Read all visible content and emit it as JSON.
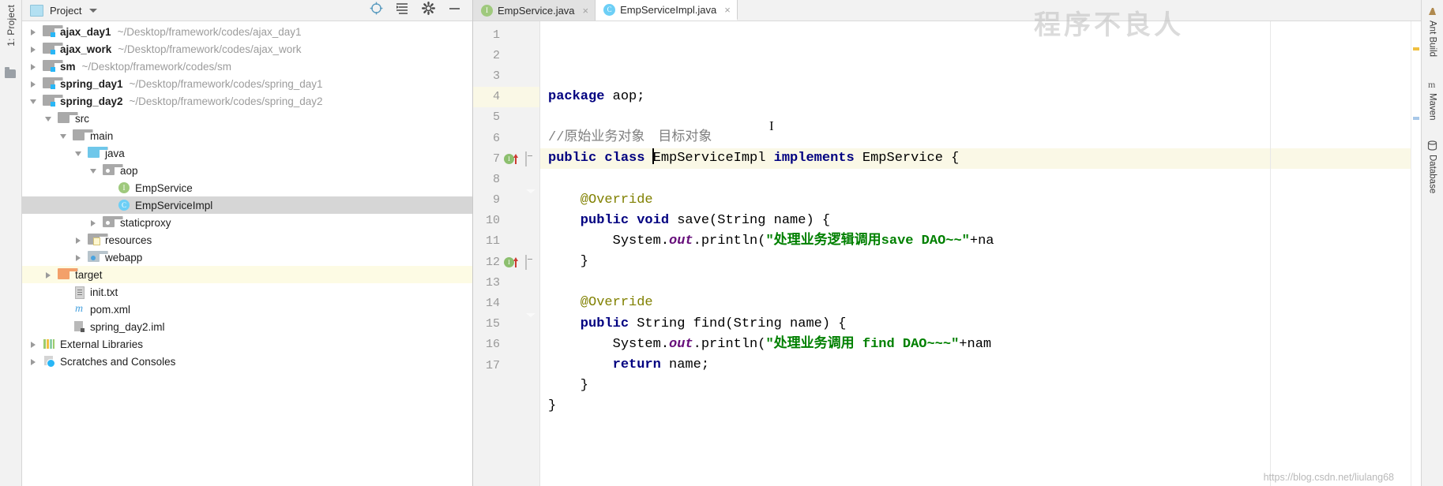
{
  "window": {
    "left_strip_label": "1: Project",
    "watermark": "程序不良人",
    "blog_url": "https://blog.csdn.net/liulang68"
  },
  "project_panel": {
    "title": "Project",
    "icons": {
      "panel": "project-icon",
      "dropdown": "chevron-down-icon",
      "locate": "crosshair-target-icon",
      "collapse": "collapse-all-icon",
      "settings": "gear-icon",
      "hide": "minimize-icon"
    },
    "tree": [
      {
        "name": "ajax_day1",
        "path": "~/Desktop/framework/codes/ajax_day1",
        "indent": 0,
        "arrow": "right",
        "icon": "module",
        "bold": true,
        "state": "normal"
      },
      {
        "name": "ajax_work",
        "path": "~/Desktop/framework/codes/ajax_work",
        "indent": 0,
        "arrow": "right",
        "icon": "module",
        "bold": true,
        "state": "normal"
      },
      {
        "name": "sm",
        "path": "~/Desktop/framework/codes/sm",
        "indent": 0,
        "arrow": "right",
        "icon": "module",
        "bold": true,
        "state": "normal"
      },
      {
        "name": "spring_day1",
        "path": "~/Desktop/framework/codes/spring_day1",
        "indent": 0,
        "arrow": "right",
        "icon": "module",
        "bold": true,
        "state": "normal"
      },
      {
        "name": "spring_day2",
        "path": "~/Desktop/framework/codes/spring_day2",
        "indent": 0,
        "arrow": "down",
        "icon": "module",
        "bold": true,
        "state": "normal"
      },
      {
        "name": "src",
        "path": "",
        "indent": 1,
        "arrow": "down",
        "icon": "folder",
        "bold": false,
        "state": "normal"
      },
      {
        "name": "main",
        "path": "",
        "indent": 2,
        "arrow": "down",
        "icon": "folder",
        "bold": false,
        "state": "normal"
      },
      {
        "name": "java",
        "path": "",
        "indent": 3,
        "arrow": "down",
        "icon": "src",
        "bold": false,
        "state": "normal"
      },
      {
        "name": "aop",
        "path": "",
        "indent": 4,
        "arrow": "down",
        "icon": "pkg",
        "bold": false,
        "state": "normal"
      },
      {
        "name": "EmpService",
        "path": "",
        "indent": 5,
        "arrow": "none",
        "icon": "iface",
        "bold": false,
        "state": "normal"
      },
      {
        "name": "EmpServiceImpl",
        "path": "",
        "indent": 5,
        "arrow": "none",
        "icon": "class",
        "bold": false,
        "state": "selected"
      },
      {
        "name": "staticproxy",
        "path": "",
        "indent": 4,
        "arrow": "right",
        "icon": "pkg",
        "bold": false,
        "state": "normal"
      },
      {
        "name": "resources",
        "path": "",
        "indent": 3,
        "arrow": "right",
        "icon": "res",
        "bold": false,
        "state": "normal"
      },
      {
        "name": "webapp",
        "path": "",
        "indent": 3,
        "arrow": "right",
        "icon": "web",
        "bold": false,
        "state": "normal"
      },
      {
        "name": "target",
        "path": "",
        "indent": 1,
        "arrow": "right",
        "icon": "target",
        "bold": false,
        "state": "highlight"
      },
      {
        "name": "init.txt",
        "path": "",
        "indent": 2,
        "arrow": "none",
        "icon": "txt",
        "bold": false,
        "state": "normal"
      },
      {
        "name": "pom.xml",
        "path": "",
        "indent": 2,
        "arrow": "none",
        "icon": "maven",
        "bold": false,
        "state": "normal"
      },
      {
        "name": "spring_day2.iml",
        "path": "",
        "indent": 2,
        "arrow": "none",
        "icon": "iml",
        "bold": false,
        "state": "normal"
      },
      {
        "name": "External Libraries",
        "path": "",
        "indent": 0,
        "arrow": "right",
        "icon": "libs",
        "bold": false,
        "state": "normal"
      },
      {
        "name": "Scratches and Consoles",
        "path": "",
        "indent": 0,
        "arrow": "right",
        "icon": "scratch",
        "bold": false,
        "state": "normal"
      }
    ]
  },
  "editor": {
    "tabs": [
      {
        "label": "EmpService.java",
        "icon": "interface-icon",
        "active": false,
        "close": "×"
      },
      {
        "label": "EmpServiceImpl.java",
        "icon": "class-icon",
        "active": true,
        "close": "×"
      }
    ],
    "line_numbers": [
      "1",
      "2",
      "3",
      "4",
      "5",
      "6",
      "7",
      "8",
      "9",
      "10",
      "11",
      "12",
      "13",
      "14",
      "15",
      "16",
      "17"
    ],
    "current_line": 4,
    "lines": [
      {
        "n": 1,
        "tokens": [
          {
            "t": "package",
            "c": "kw"
          },
          {
            "t": " aop;",
            "c": "plain-t"
          }
        ]
      },
      {
        "n": 2,
        "tokens": []
      },
      {
        "n": 3,
        "tokens": [
          {
            "t": "//原始业务对象　目标对象",
            "c": "cmt"
          }
        ]
      },
      {
        "n": 4,
        "tokens": [
          {
            "t": "public class ",
            "c": "kw"
          },
          {
            "t": "CARET",
            "c": "caret"
          },
          {
            "t": "EmpServiceImpl ",
            "c": "plain-t"
          },
          {
            "t": "implements",
            "c": "kw"
          },
          {
            "t": " EmpService {",
            "c": "plain-t"
          }
        ]
      },
      {
        "n": 5,
        "tokens": []
      },
      {
        "n": 6,
        "tokens": [
          {
            "t": "    @Override",
            "c": "ann"
          }
        ]
      },
      {
        "n": 7,
        "tokens": [
          {
            "t": "    public void ",
            "c": "kw"
          },
          {
            "t": "save(String name) {",
            "c": "plain-t"
          }
        ]
      },
      {
        "n": 8,
        "tokens": [
          {
            "t": "        System.",
            "c": "plain-t"
          },
          {
            "t": "out",
            "c": "fld"
          },
          {
            "t": ".println(",
            "c": "plain-t"
          },
          {
            "t": "\"处理业务逻辑调用save DAO~~\"",
            "c": "str"
          },
          {
            "t": "+na",
            "c": "plain-t"
          }
        ]
      },
      {
        "n": 9,
        "tokens": [
          {
            "t": "    }",
            "c": "plain-t"
          }
        ]
      },
      {
        "n": 10,
        "tokens": []
      },
      {
        "n": 11,
        "tokens": [
          {
            "t": "    @Override",
            "c": "ann"
          }
        ]
      },
      {
        "n": 12,
        "tokens": [
          {
            "t": "    public ",
            "c": "kw"
          },
          {
            "t": "String find(String name) {",
            "c": "plain-t"
          }
        ]
      },
      {
        "n": 13,
        "tokens": [
          {
            "t": "        System.",
            "c": "plain-t"
          },
          {
            "t": "out",
            "c": "fld"
          },
          {
            "t": ".println(",
            "c": "plain-t"
          },
          {
            "t": "\"处理业务调用 find DAO~~~\"",
            "c": "str"
          },
          {
            "t": "+nam",
            "c": "plain-t"
          }
        ]
      },
      {
        "n": 14,
        "tokens": [
          {
            "t": "        return",
            "c": "kw"
          },
          {
            "t": " name;",
            "c": "plain-t"
          }
        ]
      },
      {
        "n": 15,
        "tokens": [
          {
            "t": "    }",
            "c": "plain-t"
          }
        ]
      },
      {
        "n": 16,
        "tokens": [
          {
            "t": "}",
            "c": "plain-t"
          }
        ]
      },
      {
        "n": 17,
        "tokens": []
      }
    ],
    "gutter_marks": [
      {
        "line": 7,
        "type": "implementing-method-icon",
        "letter": "I"
      },
      {
        "line": 12,
        "type": "implementing-method-icon",
        "letter": "I"
      }
    ],
    "fold_lines": [
      7,
      9,
      12,
      15
    ]
  },
  "right_strip": {
    "items": [
      {
        "label": "Ant Build",
        "icon": "ant-build-icon"
      },
      {
        "label": "Maven",
        "icon": "maven-icon"
      },
      {
        "label": "Database",
        "icon": "database-icon"
      }
    ]
  },
  "colors": {
    "keyword": "#000080",
    "string": "#008000",
    "comment": "#808080",
    "annotation": "#808000",
    "field": "#660e7a",
    "selection": "#d6d6d6",
    "current_line": "#faf8e6",
    "target_highlight": "#fdfbe4",
    "panel_bg": "#f2f2f2"
  }
}
